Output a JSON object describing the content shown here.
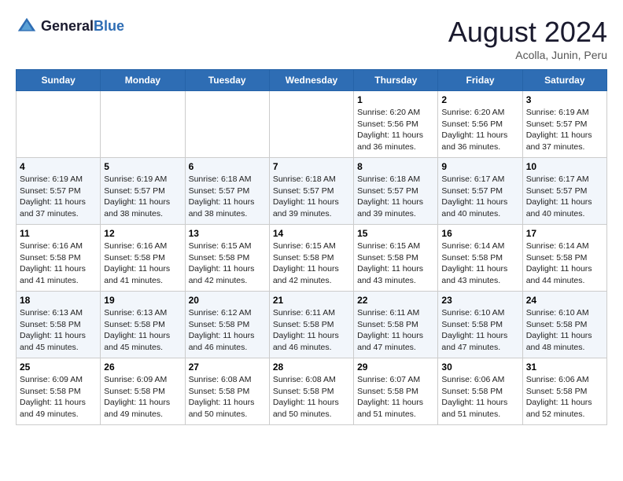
{
  "header": {
    "logo_line1": "General",
    "logo_line2": "Blue",
    "month": "August 2024",
    "location": "Acolla, Junin, Peru"
  },
  "weekdays": [
    "Sunday",
    "Monday",
    "Tuesday",
    "Wednesday",
    "Thursday",
    "Friday",
    "Saturday"
  ],
  "weeks": [
    [
      {
        "day": "",
        "info": ""
      },
      {
        "day": "",
        "info": ""
      },
      {
        "day": "",
        "info": ""
      },
      {
        "day": "",
        "info": ""
      },
      {
        "day": "1",
        "info": "Sunrise: 6:20 AM\nSunset: 5:56 PM\nDaylight: 11 hours\nand 36 minutes."
      },
      {
        "day": "2",
        "info": "Sunrise: 6:20 AM\nSunset: 5:56 PM\nDaylight: 11 hours\nand 36 minutes."
      },
      {
        "day": "3",
        "info": "Sunrise: 6:19 AM\nSunset: 5:57 PM\nDaylight: 11 hours\nand 37 minutes."
      }
    ],
    [
      {
        "day": "4",
        "info": "Sunrise: 6:19 AM\nSunset: 5:57 PM\nDaylight: 11 hours\nand 37 minutes."
      },
      {
        "day": "5",
        "info": "Sunrise: 6:19 AM\nSunset: 5:57 PM\nDaylight: 11 hours\nand 38 minutes."
      },
      {
        "day": "6",
        "info": "Sunrise: 6:18 AM\nSunset: 5:57 PM\nDaylight: 11 hours\nand 38 minutes."
      },
      {
        "day": "7",
        "info": "Sunrise: 6:18 AM\nSunset: 5:57 PM\nDaylight: 11 hours\nand 39 minutes."
      },
      {
        "day": "8",
        "info": "Sunrise: 6:18 AM\nSunset: 5:57 PM\nDaylight: 11 hours\nand 39 minutes."
      },
      {
        "day": "9",
        "info": "Sunrise: 6:17 AM\nSunset: 5:57 PM\nDaylight: 11 hours\nand 40 minutes."
      },
      {
        "day": "10",
        "info": "Sunrise: 6:17 AM\nSunset: 5:57 PM\nDaylight: 11 hours\nand 40 minutes."
      }
    ],
    [
      {
        "day": "11",
        "info": "Sunrise: 6:16 AM\nSunset: 5:58 PM\nDaylight: 11 hours\nand 41 minutes."
      },
      {
        "day": "12",
        "info": "Sunrise: 6:16 AM\nSunset: 5:58 PM\nDaylight: 11 hours\nand 41 minutes."
      },
      {
        "day": "13",
        "info": "Sunrise: 6:15 AM\nSunset: 5:58 PM\nDaylight: 11 hours\nand 42 minutes."
      },
      {
        "day": "14",
        "info": "Sunrise: 6:15 AM\nSunset: 5:58 PM\nDaylight: 11 hours\nand 42 minutes."
      },
      {
        "day": "15",
        "info": "Sunrise: 6:15 AM\nSunset: 5:58 PM\nDaylight: 11 hours\nand 43 minutes."
      },
      {
        "day": "16",
        "info": "Sunrise: 6:14 AM\nSunset: 5:58 PM\nDaylight: 11 hours\nand 43 minutes."
      },
      {
        "day": "17",
        "info": "Sunrise: 6:14 AM\nSunset: 5:58 PM\nDaylight: 11 hours\nand 44 minutes."
      }
    ],
    [
      {
        "day": "18",
        "info": "Sunrise: 6:13 AM\nSunset: 5:58 PM\nDaylight: 11 hours\nand 45 minutes."
      },
      {
        "day": "19",
        "info": "Sunrise: 6:13 AM\nSunset: 5:58 PM\nDaylight: 11 hours\nand 45 minutes."
      },
      {
        "day": "20",
        "info": "Sunrise: 6:12 AM\nSunset: 5:58 PM\nDaylight: 11 hours\nand 46 minutes."
      },
      {
        "day": "21",
        "info": "Sunrise: 6:11 AM\nSunset: 5:58 PM\nDaylight: 11 hours\nand 46 minutes."
      },
      {
        "day": "22",
        "info": "Sunrise: 6:11 AM\nSunset: 5:58 PM\nDaylight: 11 hours\nand 47 minutes."
      },
      {
        "day": "23",
        "info": "Sunrise: 6:10 AM\nSunset: 5:58 PM\nDaylight: 11 hours\nand 47 minutes."
      },
      {
        "day": "24",
        "info": "Sunrise: 6:10 AM\nSunset: 5:58 PM\nDaylight: 11 hours\nand 48 minutes."
      }
    ],
    [
      {
        "day": "25",
        "info": "Sunrise: 6:09 AM\nSunset: 5:58 PM\nDaylight: 11 hours\nand 49 minutes."
      },
      {
        "day": "26",
        "info": "Sunrise: 6:09 AM\nSunset: 5:58 PM\nDaylight: 11 hours\nand 49 minutes."
      },
      {
        "day": "27",
        "info": "Sunrise: 6:08 AM\nSunset: 5:58 PM\nDaylight: 11 hours\nand 50 minutes."
      },
      {
        "day": "28",
        "info": "Sunrise: 6:08 AM\nSunset: 5:58 PM\nDaylight: 11 hours\nand 50 minutes."
      },
      {
        "day": "29",
        "info": "Sunrise: 6:07 AM\nSunset: 5:58 PM\nDaylight: 11 hours\nand 51 minutes."
      },
      {
        "day": "30",
        "info": "Sunrise: 6:06 AM\nSunset: 5:58 PM\nDaylight: 11 hours\nand 51 minutes."
      },
      {
        "day": "31",
        "info": "Sunrise: 6:06 AM\nSunset: 5:58 PM\nDaylight: 11 hours\nand 52 minutes."
      }
    ]
  ]
}
